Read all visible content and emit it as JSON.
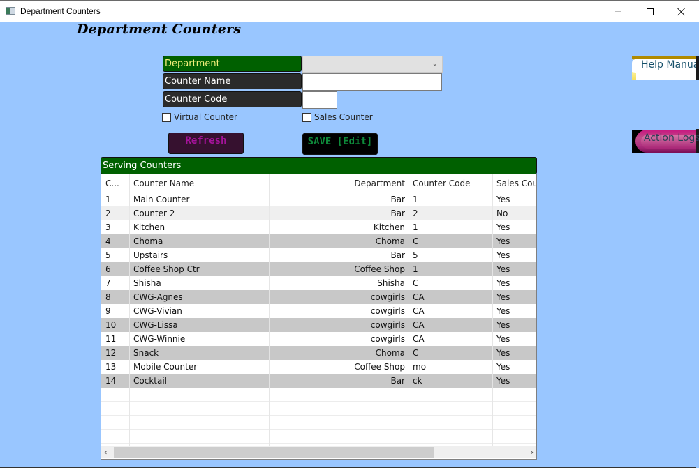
{
  "window": {
    "title": "Department Counters",
    "controls": {
      "minimize": "minimize",
      "maximize": "maximize",
      "close": "close"
    }
  },
  "page": {
    "title": "Department Counters"
  },
  "form": {
    "department_label": "Department",
    "department_value": "",
    "counter_name_label": "Counter Name",
    "counter_name_value": "",
    "counter_code_label": "Counter Code",
    "counter_code_value": "",
    "virtual_counter_label": "Virtual Counter",
    "virtual_counter_checked": false,
    "sales_counter_label": "Sales Counter",
    "sales_counter_checked": false
  },
  "buttons": {
    "refresh": "Refresh",
    "save": "SAVE [Edit]",
    "help_manual": "Help Manual",
    "action_logs": "Action Logs"
  },
  "grid": {
    "title": "Serving Counters",
    "columns": [
      "C...",
      "Counter Name",
      "Department",
      "Counter Code",
      "Sales Coun"
    ],
    "rows": [
      [
        "1",
        "Main Counter",
        "Bar",
        "1",
        "Yes"
      ],
      [
        "2",
        "Counter 2",
        "Bar",
        "2",
        "No"
      ],
      [
        "3",
        "Kitchen",
        "Kitchen",
        "1",
        "Yes"
      ],
      [
        "4",
        "Choma",
        "Choma",
        "C",
        "Yes"
      ],
      [
        "5",
        "Upstairs",
        "Bar",
        "5",
        "Yes"
      ],
      [
        "6",
        "Coffee Shop Ctr",
        "Coffee Shop",
        "1",
        "Yes"
      ],
      [
        "7",
        "Shisha",
        "Shisha",
        "C",
        "Yes"
      ],
      [
        "8",
        "CWG-Agnes",
        "cowgirls",
        "CA",
        "Yes"
      ],
      [
        "9",
        "CWG-Vivian",
        "cowgirls",
        "CA",
        "Yes"
      ],
      [
        "10",
        "CWG-Lissa",
        "cowgirls",
        "CA",
        "Yes"
      ],
      [
        "11",
        "CWG-Winnie",
        "cowgirls",
        "CA",
        "Yes"
      ],
      [
        "12",
        "Snack",
        "Choma",
        "C",
        "Yes"
      ],
      [
        "13",
        "Mobile Counter",
        "Coffee Shop",
        "mo",
        "Yes"
      ],
      [
        "14",
        "Cocktail",
        "Bar",
        "ck",
        "Yes"
      ]
    ],
    "row_styles": [
      "white",
      "light",
      "white",
      "dark",
      "white",
      "dark",
      "white",
      "dark",
      "white",
      "dark",
      "white",
      "dark",
      "white",
      "dark"
    ],
    "scroll_left_icon": "‹",
    "scroll_right_icon": "›"
  },
  "colors": {
    "background": "#99c6ff",
    "header_green": "#006000",
    "label_dark": "#2b2b2b",
    "department_text": "#f2ee7a",
    "refresh_bg": "#36112f",
    "refresh_text": "#a5139a",
    "save_bg": "#000000",
    "save_text": "#0e8a3a"
  }
}
